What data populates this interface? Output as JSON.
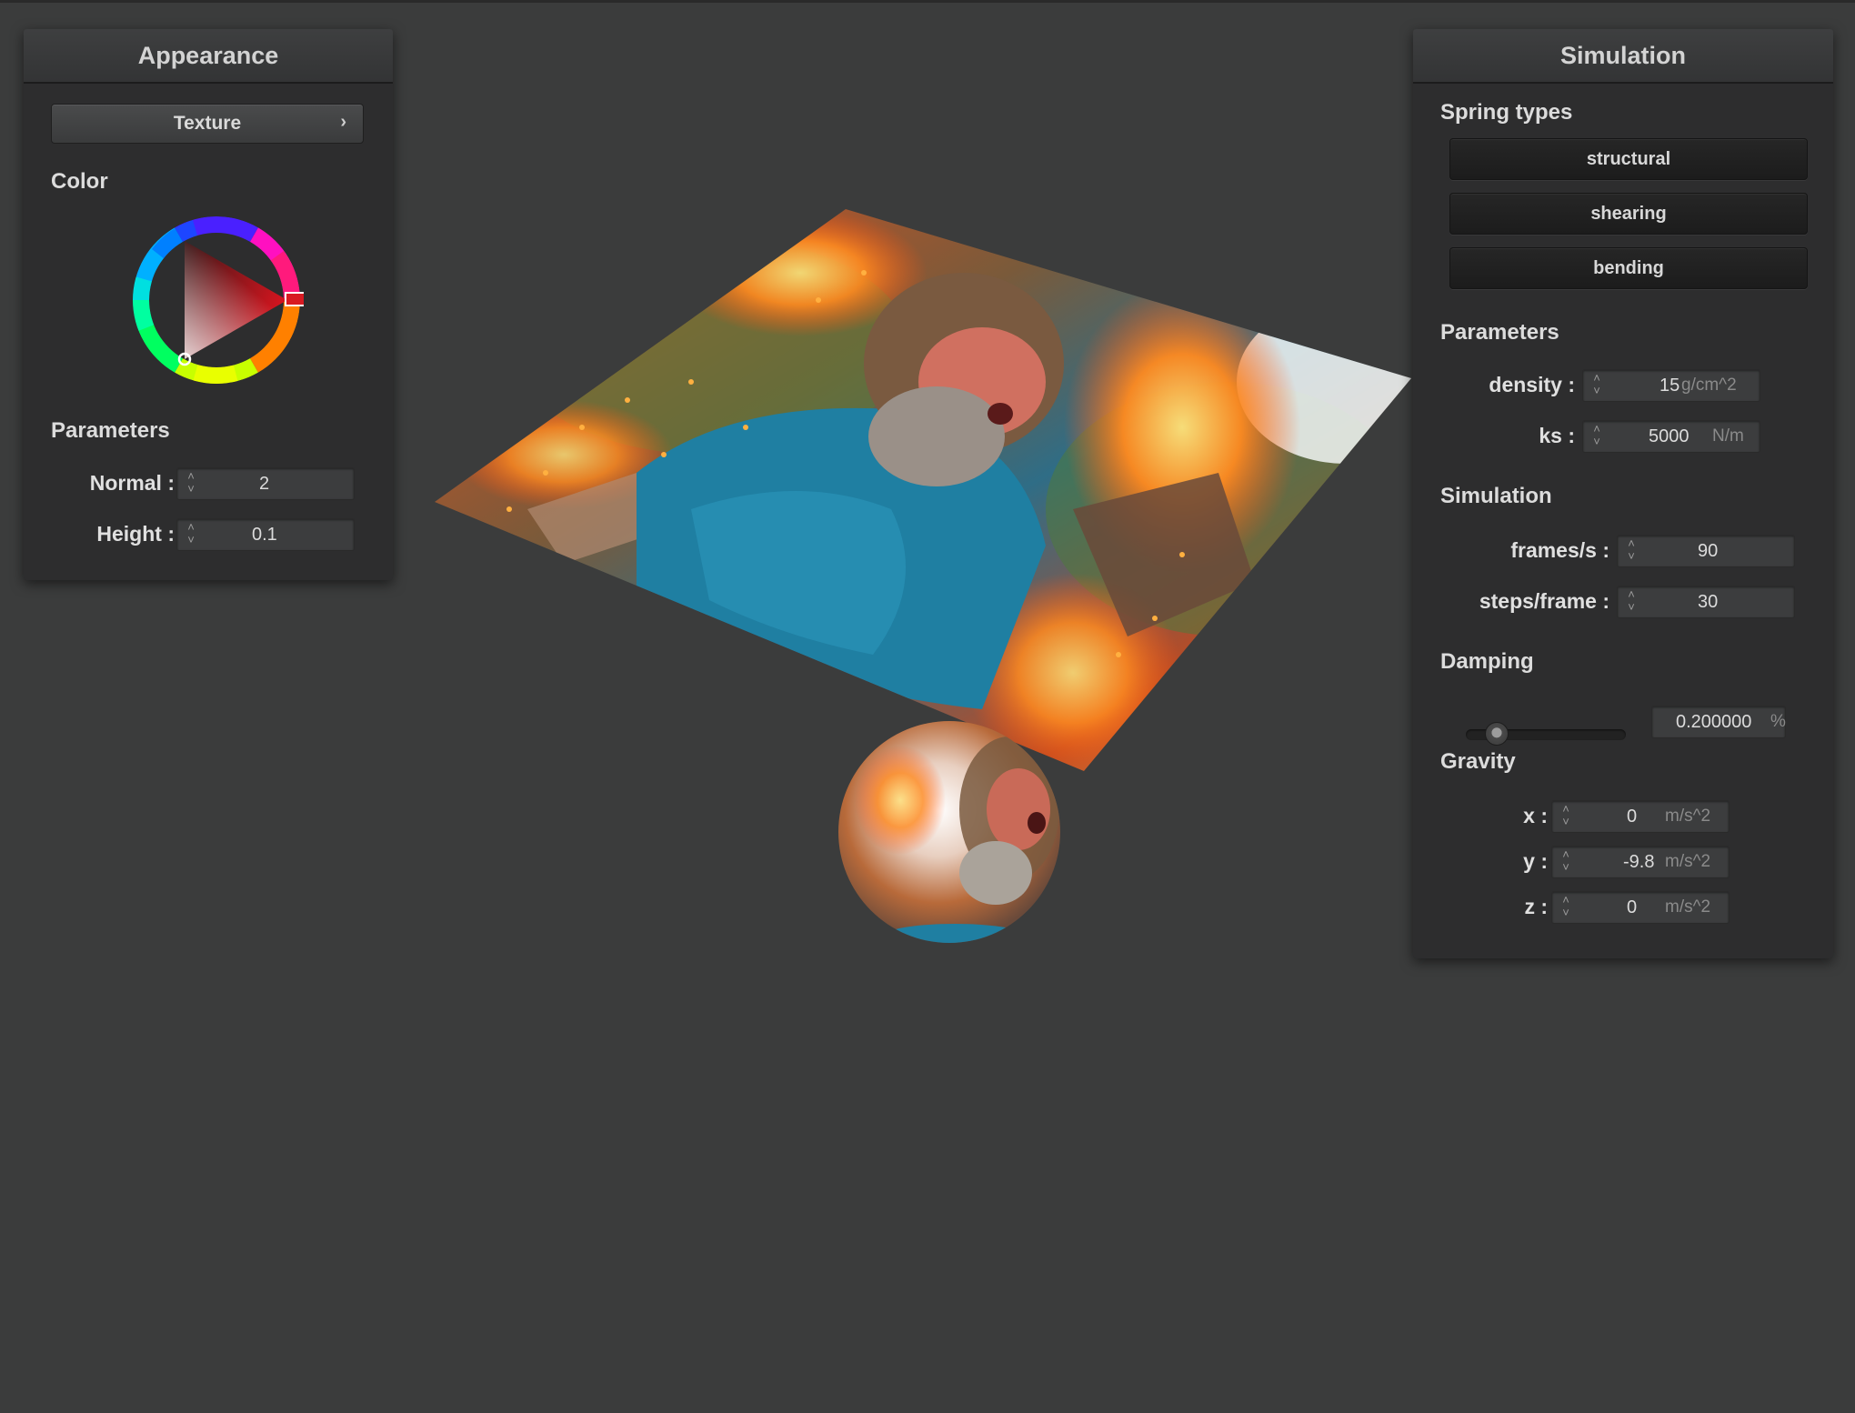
{
  "appearance": {
    "title": "Appearance",
    "texture_button": "Texture",
    "color_label": "Color",
    "parameters_label": "Parameters",
    "normal_label": "Normal :",
    "normal_value": "2",
    "height_label": "Height :",
    "height_value": "0.1",
    "selected_color": "#cc1a22"
  },
  "simulation": {
    "title": "Simulation",
    "spring_types_label": "Spring types",
    "spring_types": [
      "structural",
      "shearing",
      "bending"
    ],
    "parameters_label": "Parameters",
    "density_label": "density :",
    "density_value": "15",
    "density_unit": "g/cm^2",
    "ks_label": "ks :",
    "ks_value": "5000",
    "ks_unit": "N/m",
    "simulation_label": "Simulation",
    "fps_label": "frames/s :",
    "fps_value": "90",
    "steps_label": "steps/frame :",
    "steps_value": "30",
    "damping_label": "Damping",
    "damping_value": "0.200000",
    "damping_unit": "%",
    "damping_fraction": 0.2,
    "gravity_label": "Gravity",
    "gx_label": "x :",
    "gx_value": "0",
    "gy_label": "y :",
    "gy_value": "-9.8",
    "gz_label": "z :",
    "gz_value": "0",
    "gravity_unit": "m/s^2"
  }
}
